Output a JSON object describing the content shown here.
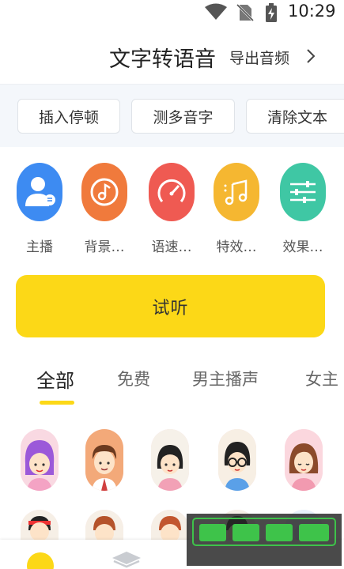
{
  "status_bar": {
    "time": "10:29",
    "icons": [
      "wifi-icon",
      "no-sim-icon",
      "battery-charging-icon"
    ]
  },
  "header": {
    "title": "文字转语音",
    "export_label": "导出音频",
    "export_icon": "chevron-right-icon"
  },
  "toolbar": {
    "buttons": [
      "插入停顿",
      "测多音字",
      "清除文本"
    ]
  },
  "features": [
    {
      "label": "主播",
      "icon": "anchor-person-icon",
      "color": "#3d8bf2"
    },
    {
      "label": "背景…",
      "icon": "music-note-icon",
      "color": "#f07a3c"
    },
    {
      "label": "语速…",
      "icon": "speedometer-icon",
      "color": "#ef5a52"
    },
    {
      "label": "特效…",
      "icon": "music-score-icon",
      "color": "#f5b731"
    },
    {
      "label": "效果…",
      "icon": "equalizer-icon",
      "color": "#3fc7a4"
    }
  ],
  "listen_button": {
    "label": "试听",
    "color": "#fcd817"
  },
  "tabs": [
    {
      "label": "全部",
      "active": true
    },
    {
      "label": "免费",
      "active": false
    },
    {
      "label": "男主播声",
      "active": false
    },
    {
      "label": "女主",
      "active": false
    }
  ],
  "colors": {
    "accent": "#fcd817",
    "toolbar_bg": "#f4f7fb"
  }
}
